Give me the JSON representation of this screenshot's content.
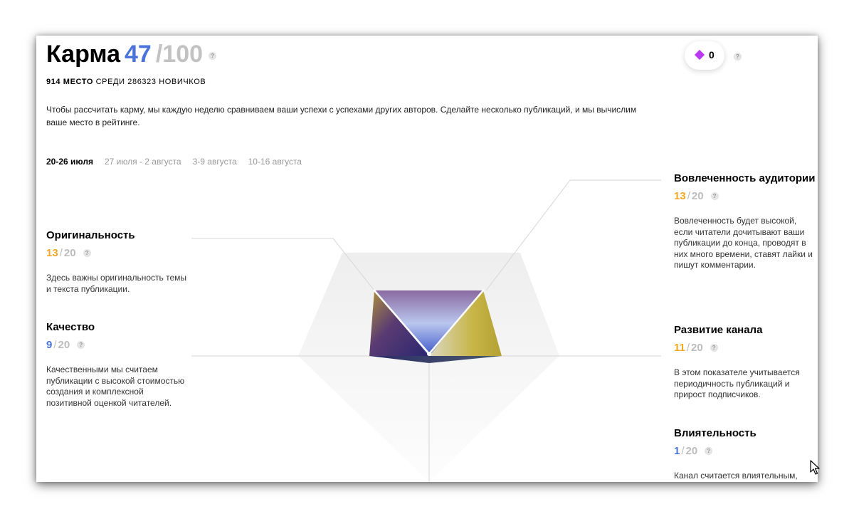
{
  "header": {
    "title": "Карма",
    "score": "47",
    "max": "/100",
    "rank_place": "914 МЕСТО",
    "rank_rest": "СРЕДИ 286323 НОВИЧКОВ",
    "intro": "Чтобы рассчитать карму, мы каждую неделю сравниваем ваши успехи с успехами других авторов. Сделайте несколько публикаций, и мы вычислим ваше место в рейтинге.",
    "help_glyph": "?"
  },
  "badge": {
    "count": "0",
    "icon": "diamond-icon",
    "color": "#b83bf2"
  },
  "weeks": [
    "20-26 июля",
    "27 июля - 2 августа",
    "3-9 августа",
    "10-16 августа"
  ],
  "metrics": {
    "originality": {
      "name": "Оригинальность",
      "value": "13",
      "max": "20",
      "desc": "Здесь важны оригинальность темы и текста публикации."
    },
    "quality": {
      "name": "Качество",
      "value": "9",
      "max": "20",
      "desc": "Качественными мы считаем публикации с высокой стоимостью создания и комплексной позитивной оценкой читателей."
    },
    "engagement": {
      "name": "Вовлеченность аудитории",
      "value": "13",
      "max": "20",
      "desc": "Вовлеченность будет высокой, если читатели дочитывают ваши публикации до конца, проводят в них много времени, ставят лайки и пишут комментарии."
    },
    "growth": {
      "name": "Развитие канала",
      "value": "11",
      "max": "20",
      "desc": "В этом показателе учитывается периодичность публикаций и прирост подписчиков."
    },
    "influence": {
      "name": "Влиятельность",
      "value": "1",
      "max": "20",
      "desc": "Канал считается влиятельным, если"
    }
  },
  "colors": {
    "accent_blue": "#4a74dc",
    "accent_orange": "#f5a623",
    "muted": "#bcbcbc"
  }
}
